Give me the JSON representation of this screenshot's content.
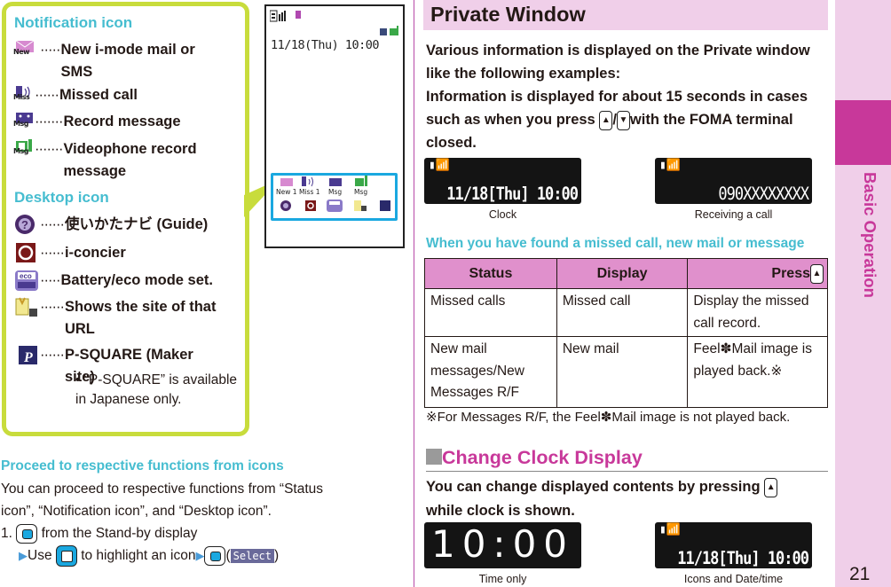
{
  "callout": {
    "notification_heading": "Notification icon",
    "notification_items": [
      {
        "icon": "new-mail-icon",
        "icon_label": "New",
        "dots": "·····",
        "text": "New i-mode mail or SMS"
      },
      {
        "icon": "missed-call-icon",
        "icon_label": "Miss",
        "dots": "······",
        "text": "Missed call"
      },
      {
        "icon": "record-message-icon",
        "icon_label": "Msg",
        "dots": "·······",
        "text": "Record message"
      },
      {
        "icon": "videophone-record-icon",
        "icon_label": "Msg",
        "dots": "·······",
        "text": "Videophone record message"
      }
    ],
    "desktop_heading": "Desktop icon",
    "desktop_items": [
      {
        "icon": "guide-icon",
        "dots": "······",
        "text": "使いかたナビ (Guide)"
      },
      {
        "icon": "i-concier-icon",
        "dots": "······",
        "text": "i-concier"
      },
      {
        "icon": "eco-mode-icon",
        "icon_label": "eco",
        "dots": "·····",
        "text": "Battery/eco mode set."
      },
      {
        "icon": "url-site-icon",
        "dots": "······",
        "text": "Shows the site of that URL"
      },
      {
        "icon": "p-square-icon",
        "icon_label": "P",
        "dots": "······",
        "text": "P-SQUARE (Maker site)"
      }
    ],
    "note": "• “P-SQUARE” is available in Japanese only."
  },
  "phone": {
    "date_time": "11/18(Thu) 10:00",
    "notification_labels": [
      "New 1",
      "Miss 1",
      "Msg",
      "Msg"
    ]
  },
  "proceed": {
    "heading": "Proceed to respective functions from icons",
    "line1": "You can proceed to respective functions from “Status",
    "line2": "icon”, “Notification icon”, and “Desktop icon”.",
    "step_num": "1.",
    "step_text": "from the Stand-by display",
    "use_label": "Use",
    "highlight_text": "to highlight an icon",
    "softkey": "Select"
  },
  "private_window": {
    "title": "Private Window",
    "intro_1": "Various information is displayed on the Private window like the following examples:",
    "intro_2a": "Information is displayed for about 15 seconds in cases such as when you press",
    "intro_2b": "with the FOMA terminal closed.",
    "examples": [
      {
        "screen_text": "11/18[Thu] 10:00",
        "caption": "Clock"
      },
      {
        "screen_text": "090XXXXXXXX",
        "caption": "Receiving a call"
      }
    ],
    "missed_heading": "When you have found a missed call, new mail or message",
    "table": {
      "headers": [
        "Status",
        "Display",
        "Press"
      ],
      "rows": [
        [
          "Missed calls",
          "Missed call",
          "Display the missed call record."
        ],
        [
          "New mail messages/New Messages R/F",
          "New mail",
          "Feel✽Mail image is played back.※"
        ]
      ]
    },
    "footnote": "※For Messages R/F, the Feel✽Mail image is not played back."
  },
  "change_clock": {
    "title": "Change Clock Display",
    "text_a": "You can change displayed contents by pressing",
    "text_b": "while clock is shown.",
    "examples": [
      {
        "screen_text": "10:00",
        "caption": "Time only"
      },
      {
        "screen_text": "11/18[Thu] 10:00",
        "caption": "Icons and Date/time"
      }
    ]
  },
  "side": {
    "label": "Basic Operation",
    "page_number": "21"
  },
  "colors": {
    "accent_magenta": "#c8389a",
    "accent_cyan": "#46bdd0",
    "callout_green": "#c8dc3c",
    "banner_pink": "#f0cfe9",
    "table_header": "#e090cc"
  }
}
